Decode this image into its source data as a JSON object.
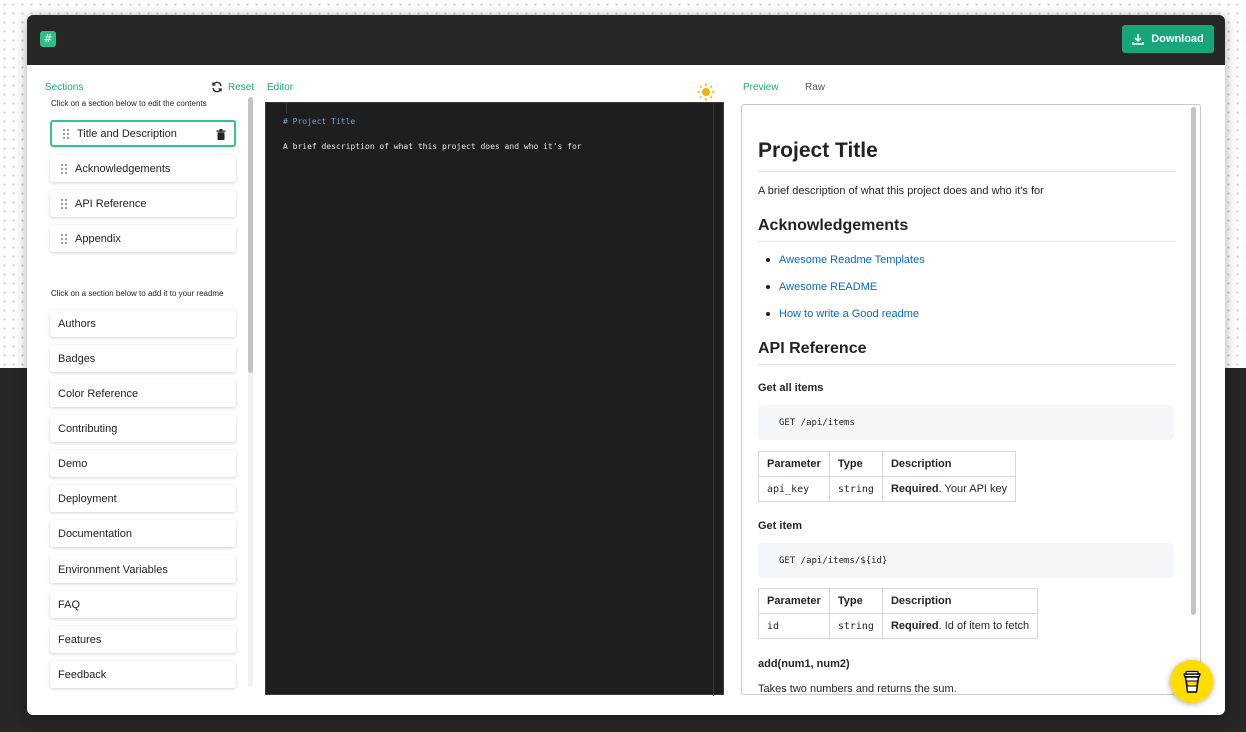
{
  "header": {
    "download_label": "Download"
  },
  "sidebar": {
    "title": "Sections",
    "reset_label": "Reset",
    "selected_hint": "Click on a section below to edit the contents",
    "selected": [
      {
        "label": "Title and Description"
      },
      {
        "label": "Acknowledgements"
      },
      {
        "label": "API Reference"
      },
      {
        "label": "Appendix"
      }
    ],
    "add_hint": "Click on a section below to add it to your readme",
    "available": [
      {
        "label": "Authors"
      },
      {
        "label": "Badges"
      },
      {
        "label": "Color Reference"
      },
      {
        "label": "Contributing"
      },
      {
        "label": "Demo"
      },
      {
        "label": "Deployment"
      },
      {
        "label": "Documentation"
      },
      {
        "label": "Environment Variables"
      },
      {
        "label": "FAQ"
      },
      {
        "label": "Features"
      },
      {
        "label": "Feedback"
      }
    ]
  },
  "editor": {
    "title": "Editor",
    "lines": [
      "# Project Title",
      "A brief description of what this project does and who it's for"
    ]
  },
  "preview": {
    "tabs": [
      "Preview",
      "Raw"
    ],
    "h1": "Project Title",
    "description": "A brief description of what this project does and who it's for",
    "ack_heading": "Acknowledgements",
    "links": [
      "Awesome Readme Templates",
      "Awesome README",
      "How to write a Good readme"
    ],
    "api_heading": "API Reference",
    "get_all_heading": "Get all items",
    "get_all_code": "GET /api/items",
    "table_headers": [
      "Parameter",
      "Type",
      "Description"
    ],
    "table1": {
      "param": "api_key",
      "type": "string",
      "req": "Required",
      "desc": ". Your API key"
    },
    "get_item_heading": "Get item",
    "get_item_code": "GET /api/items/${id}",
    "table2": {
      "param": "id",
      "type": "string",
      "req": "Required",
      "desc": ". Id of item to fetch"
    },
    "add_heading": "add(num1, num2)",
    "add_desc": "Takes two numbers and returns the sum."
  },
  "colors": {
    "accent": "#1ea77a",
    "download_bg": "#17a57a",
    "link": "#0b69c2",
    "editor_bg": "#1e1e1e",
    "coffee": "#ffdd00"
  },
  "icons": [
    "logo-icon",
    "download-icon",
    "refresh-icon",
    "sun-icon",
    "drag-handle-icon",
    "trash-icon",
    "coffee-cup-icon"
  ]
}
